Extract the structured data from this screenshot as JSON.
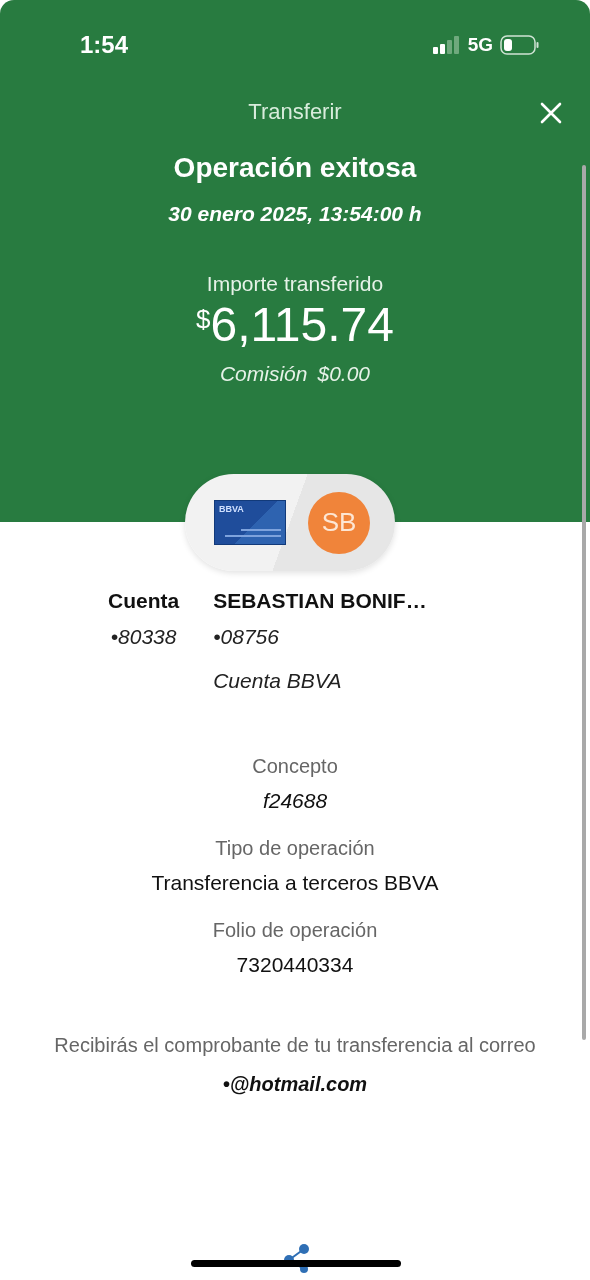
{
  "status_bar": {
    "time": "1:54",
    "network": "5G"
  },
  "header": {
    "title": "Transferir"
  },
  "result": {
    "title": "Operación exitosa",
    "date": "30 enero 2025, 13:54:00 h",
    "amount_label": "Importe transferido",
    "currency": "$",
    "amount": "6,115.74",
    "commission_label": "Comisión",
    "commission": "$0.00"
  },
  "origin": {
    "card_label": "BBVA",
    "name": "Cuenta",
    "number": "•80338"
  },
  "destination": {
    "initials": "SB",
    "name": "SEBASTIAN BONIF…",
    "number": "•08756",
    "bank": "Cuenta BBVA"
  },
  "details": [
    {
      "label": "Concepto",
      "value": "f24688",
      "kind": "reference"
    },
    {
      "label": "Tipo de operación",
      "value": "Transferencia a terceros BBVA",
      "kind": "text"
    },
    {
      "label": "Folio de operación",
      "value": "7320440334",
      "kind": "text"
    }
  ],
  "notice": {
    "text": "Recibirás el comprobante de tu transferencia al correo",
    "email": "•@hotmail.com"
  }
}
